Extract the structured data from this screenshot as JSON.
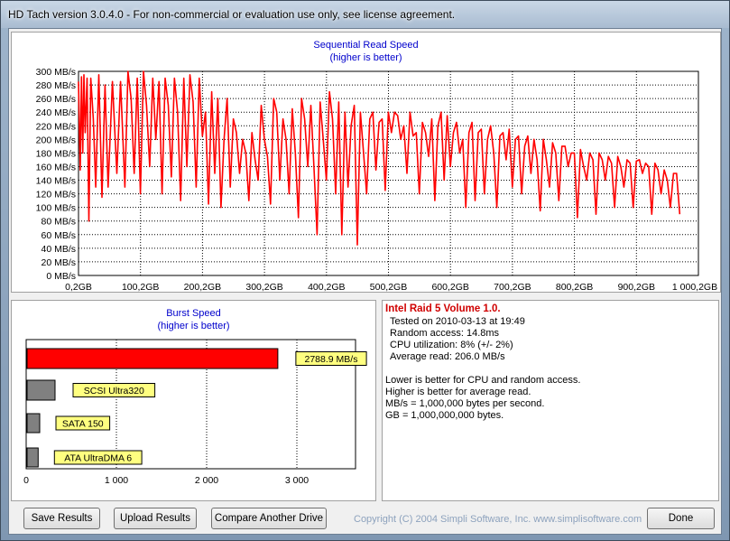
{
  "window": {
    "title": "HD Tach version 3.0.4.0  - For non-commercial or evaluation use only, see license agreement."
  },
  "seq_chart": {
    "title": "Sequential Read Speed",
    "subtitle": "(higher is better)"
  },
  "burst_chart": {
    "title": "Burst Speed",
    "subtitle": "(higher is better)"
  },
  "chart_data": [
    {
      "type": "line",
      "title": "Sequential Read Speed",
      "subtitle": "(higher is better)",
      "x_ticks": [
        "0,2GB",
        "100,2GB",
        "200,2GB",
        "300,2GB",
        "400,2GB",
        "500,2GB",
        "600,2GB",
        "700,2GB",
        "800,2GB",
        "900,2GB",
        "1 000,2GB"
      ],
      "y_ticks": [
        "0 MB/s",
        "20 MB/s",
        "40 MB/s",
        "60 MB/s",
        "80 MB/s",
        "100 MB/s",
        "120 MB/s",
        "140 MB/s",
        "160 MB/s",
        "180 MB/s",
        "200 MB/s",
        "220 MB/s",
        "240 MB/s",
        "260 MB/s",
        "280 MB/s",
        "300 MB/s"
      ],
      "xlim": [
        0.2,
        1000.2
      ],
      "ylim": [
        0,
        300
      ],
      "grid": true,
      "series_color": "#ff0000",
      "x": [
        0.2,
        3,
        5,
        7,
        9,
        11,
        14,
        17,
        20,
        24,
        28,
        33,
        38,
        43,
        48,
        55,
        62,
        68,
        75,
        80,
        85,
        90,
        95,
        100,
        105,
        110,
        115,
        120,
        125,
        130,
        135,
        140,
        145,
        150,
        155,
        160,
        165,
        170,
        175,
        180,
        185,
        190,
        195,
        200,
        205,
        210,
        215,
        220,
        225,
        230,
        235,
        240,
        245,
        250,
        255,
        260,
        265,
        270,
        275,
        280,
        285,
        290,
        295,
        300,
        305,
        310,
        315,
        320,
        325,
        330,
        335,
        340,
        345,
        350,
        355,
        360,
        365,
        370,
        375,
        380,
        385,
        390,
        395,
        400,
        405,
        410,
        415,
        420,
        425,
        430,
        435,
        440,
        445,
        450,
        455,
        460,
        465,
        470,
        475,
        480,
        485,
        490,
        495,
        500,
        505,
        510,
        515,
        520,
        525,
        530,
        535,
        540,
        545,
        550,
        555,
        560,
        565,
        570,
        575,
        580,
        585,
        590,
        595,
        600,
        605,
        610,
        615,
        620,
        625,
        630,
        635,
        640,
        645,
        650,
        655,
        660,
        665,
        670,
        675,
        680,
        685,
        690,
        695,
        700,
        705,
        710,
        715,
        720,
        725,
        730,
        735,
        740,
        745,
        750,
        755,
        760,
        765,
        770,
        775,
        780,
        785,
        790,
        795,
        800,
        805,
        810,
        815,
        820,
        825,
        830,
        835,
        840,
        845,
        850,
        855,
        860,
        865,
        870,
        875,
        880,
        885,
        890,
        895,
        900,
        905,
        910,
        915,
        920,
        925,
        930,
        935,
        940,
        945,
        950,
        955,
        960,
        965,
        970,
        975,
        980,
        985,
        990,
        995,
        1000.2
      ],
      "y": [
        285,
        155,
        292,
        180,
        295,
        210,
        290,
        80,
        290,
        230,
        130,
        295,
        115,
        280,
        130,
        285,
        150,
        285,
        130,
        300,
        260,
        150,
        290,
        120,
        300,
        250,
        160,
        290,
        200,
        285,
        120,
        290,
        250,
        145,
        290,
        240,
        110,
        290,
        160,
        295,
        255,
        130,
        290,
        205,
        240,
        105,
        270,
        150,
        260,
        100,
        200,
        260,
        130,
        230,
        210,
        150,
        200,
        180,
        110,
        210,
        170,
        140,
        250,
        200,
        175,
        105,
        260,
        240,
        140,
        230,
        200,
        120,
        245,
        180,
        85,
        260,
        230,
        160,
        250,
        160,
        60,
        255,
        200,
        140,
        270,
        230,
        120,
        255,
        60,
        240,
        130,
        220,
        250,
        45,
        240,
        180,
        120,
        230,
        240,
        155,
        225,
        230,
        125,
        240,
        210,
        240,
        235,
        200,
        220,
        150,
        240,
        205,
        210,
        120,
        225,
        210,
        175,
        230,
        110,
        220,
        240,
        140,
        235,
        160,
        210,
        225,
        180,
        200,
        100,
        210,
        225,
        110,
        210,
        215,
        120,
        200,
        220,
        180,
        100,
        205,
        210,
        170,
        215,
        130,
        200,
        205,
        120,
        190,
        205,
        150,
        200,
        170,
        95,
        200,
        170,
        130,
        195,
        180,
        110,
        190,
        190,
        160,
        180,
        180,
        85,
        185,
        160,
        140,
        180,
        170,
        90,
        180,
        170,
        140,
        175,
        165,
        100,
        175,
        160,
        130,
        170,
        165,
        100,
        168,
        170,
        150,
        165,
        160,
        90,
        165,
        155,
        120,
        155,
        140,
        100,
        150,
        150,
        90
      ]
    },
    {
      "type": "bar",
      "title": "Burst Speed",
      "subtitle": "(higher is better)",
      "orientation": "horizontal",
      "categories": [
        "2788.9 MB/s",
        "SCSI Ultra320",
        "SATA 150",
        "ATA UltraDMA 6"
      ],
      "values": [
        2788.9,
        320,
        150,
        133
      ],
      "colors": [
        "#ff0000",
        "#808080",
        "#808080",
        "#808080"
      ],
      "x_ticks": [
        "0",
        "1 000",
        "2 000",
        "3 000"
      ],
      "xlim": [
        0,
        3650
      ],
      "label_bg": "#ffff80"
    }
  ],
  "info": {
    "heading": "Intel Raid 5 Volume 1.0.",
    "tested_on": "Tested on 2010-03-13 at 19:49",
    "random_access": "Random access: 14.8ms",
    "cpu": "CPU utilization: 8% (+/- 2%)",
    "average_read": "Average read: 206.0 MB/s",
    "note1": "Lower is better for CPU and random access.",
    "note2": "Higher is better for average read.",
    "note3": "MB/s = 1,000,000 bytes per second.",
    "note4": "GB = 1,000,000,000 bytes."
  },
  "buttons": {
    "save": "Save Results",
    "upload": "Upload Results",
    "compare": "Compare Another Drive",
    "done": "Done"
  },
  "footer": {
    "copyright": "Copyright (C) 2004 Simpli Software, Inc. www.simplisoftware.com"
  }
}
